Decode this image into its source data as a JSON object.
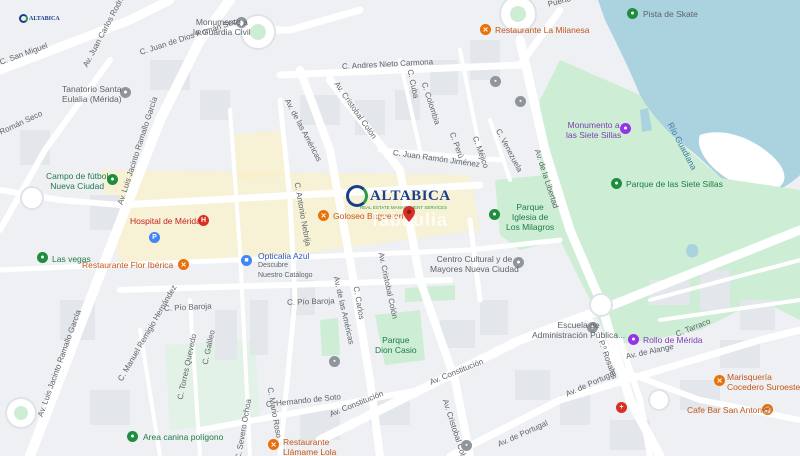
{
  "map": {
    "colors": {
      "background": "#eef0f3",
      "road": "#ffffff",
      "major_road": "#dfe3e8",
      "water": "#aad3df",
      "park": "#cdeed4",
      "block": "#e3e6ea",
      "highlight": "#fbf1c7"
    },
    "brand": {
      "name": "ALTABICA",
      "subtitle": "REAL ESTATE MANAGEMENT SERVICES",
      "watermark": "fabaulia"
    },
    "water_labels": [
      {
        "text": "Río Guadiana"
      }
    ],
    "streets": [
      {
        "text": "C. Andres Nieto Carmona"
      },
      {
        "text": "Av. Cristobal Colón"
      },
      {
        "text": "C. Colombia"
      },
      {
        "text": "C. Juan Ramón Jiménez"
      },
      {
        "text": "Av. de las Américas"
      },
      {
        "text": "C. Antonio Nebrija"
      },
      {
        "text": "C. Pío Baroja"
      },
      {
        "text": "C. Pío Baroja"
      },
      {
        "text": "Av. de las Américas"
      },
      {
        "text": "Av. Cristobal Colón"
      },
      {
        "text": "C. Carlos"
      },
      {
        "text": "C. Hernando de Soto"
      },
      {
        "text": "Av. Constitución"
      },
      {
        "text": "Av. Constitución"
      },
      {
        "text": "Av. Cristobal Colón"
      },
      {
        "text": "Av. de Portugal"
      },
      {
        "text": "Av. de Portugal"
      },
      {
        "text": "Av. de la Libertad"
      },
      {
        "text": "C. Juan de Dios Román Seco"
      },
      {
        "text": "Av. Juan Carlos Rodríguez"
      },
      {
        "text": "Av. Luis Jacinto Ramallo García"
      },
      {
        "text": "Av. Luis Jacinto Ramallo García"
      },
      {
        "text": "C. Manuel Remigio Hernández"
      },
      {
        "text": "C. Torres Quevedo"
      },
      {
        "text": "C. Galileo"
      },
      {
        "text": "C. Severo Ochoa"
      },
      {
        "text": "C. Mario Roso"
      },
      {
        "text": "Av. de Alange"
      },
      {
        "text": "P.º Rosales"
      },
      {
        "text": "C. Tarraco"
      },
      {
        "text": "C. Cuba"
      },
      {
        "text": "C. Perú"
      },
      {
        "text": "C. Méjico"
      },
      {
        "text": "C. Venezuela"
      },
      {
        "text": "C. San Miguel"
      },
      {
        "text": "Román Seco"
      },
      {
        "text": "Puerto"
      }
    ],
    "pois": [
      {
        "name": "Monumento a la Guardia Civil",
        "lines": [
          "Monumento a",
          "la Guardia Civil"
        ],
        "icon": "landmark-icon",
        "color": "gray"
      },
      {
        "name": "Restaurante La Milanesa",
        "lines": [
          "Restaurante La Milanesa"
        ],
        "icon": "restaurant-icon",
        "color": "orange"
      },
      {
        "name": "Pista de Skate",
        "lines": [
          "Pista de Skate"
        ],
        "icon": "park-icon",
        "color": "green"
      },
      {
        "name": "Tanatorio Santa Eulalia (Mérida)",
        "lines": [
          "Tanatorio Santa",
          "Eulalia (Mérida)"
        ],
        "icon": "service-icon",
        "color": "gray"
      },
      {
        "name": "Monumento a las Siete Sillas",
        "lines": [
          "Monumento a",
          "las Siete Sillas"
        ],
        "icon": "monument-icon",
        "color": "purple"
      },
      {
        "name": "Parque de las Siete Sillas",
        "lines": [
          "Parque de las Siete Sillas"
        ],
        "icon": "park-icon",
        "color": "green"
      },
      {
        "name": "Campo de fútbol Nueva Ciudad",
        "lines": [
          "Campo de fútbol",
          "Nueva Ciudad"
        ],
        "icon": "sports-icon",
        "color": "green"
      },
      {
        "name": "Hospital de Mérida",
        "lines": [
          "Hospital de Mérida"
        ],
        "icon": "hospital-icon",
        "color": "red"
      },
      {
        "name": "Goloseo Baguetería",
        "lines": [
          "Goloseo Baguetería"
        ],
        "icon": "restaurant-icon",
        "color": "orange"
      },
      {
        "name": "Parque Iglesia de Los Milagros",
        "lines": [
          "Parque",
          "Iglesia de",
          "Los Milagros"
        ],
        "icon": "park-icon",
        "color": "green"
      },
      {
        "name": "Las vegas",
        "lines": [
          "Las vegas"
        ],
        "icon": "park-icon",
        "color": "green"
      },
      {
        "name": "Restaurante Flor Ibérica",
        "lines": [
          "Restaurante Flor Ibérica"
        ],
        "icon": "restaurant-icon",
        "color": "orange"
      },
      {
        "name": "Opticalia Azul",
        "lines": [
          "Opticalia Azul",
          "Descubre",
          "Nuestro Catálogo"
        ],
        "icon": "shop-icon",
        "color": "blue"
      },
      {
        "name": "Centro Cultural y de Mayores Nueva Ciudad",
        "lines": [
          "Centro Cultural y de",
          "Mayores Nueva Ciudad"
        ],
        "icon": "building-icon",
        "color": "gray"
      },
      {
        "name": "Escuela de Administración Pública",
        "lines": [
          "Escuela de",
          "Administración Pública..."
        ],
        "icon": "school-icon",
        "color": "gray"
      },
      {
        "name": "Parque Dion Casio",
        "lines": [
          "Parque",
          "Dion Casio"
        ],
        "icon": "park-icon",
        "color": "green"
      },
      {
        "name": "Rollo de Mérida",
        "lines": [
          "Rollo de Mérida"
        ],
        "icon": "monument-icon",
        "color": "purple"
      },
      {
        "name": "Marisquería Cocedero Suroeste",
        "lines": [
          "Marisquería",
          "Cocedero Suroeste"
        ],
        "icon": "restaurant-icon",
        "color": "orange"
      },
      {
        "name": "Cafe Bar San Antonio",
        "lines": [
          "Cafe Bar San Antonio"
        ],
        "icon": "cafe-icon",
        "color": "orange"
      },
      {
        "name": "Area canina polígono",
        "lines": [
          "Area canina polígono"
        ],
        "icon": "park-icon",
        "color": "green"
      },
      {
        "name": "Restaurante Llámame Lola",
        "lines": [
          "Restaurante",
          "Llámame Lola"
        ],
        "icon": "restaurant-icon",
        "color": "orange"
      }
    ]
  }
}
